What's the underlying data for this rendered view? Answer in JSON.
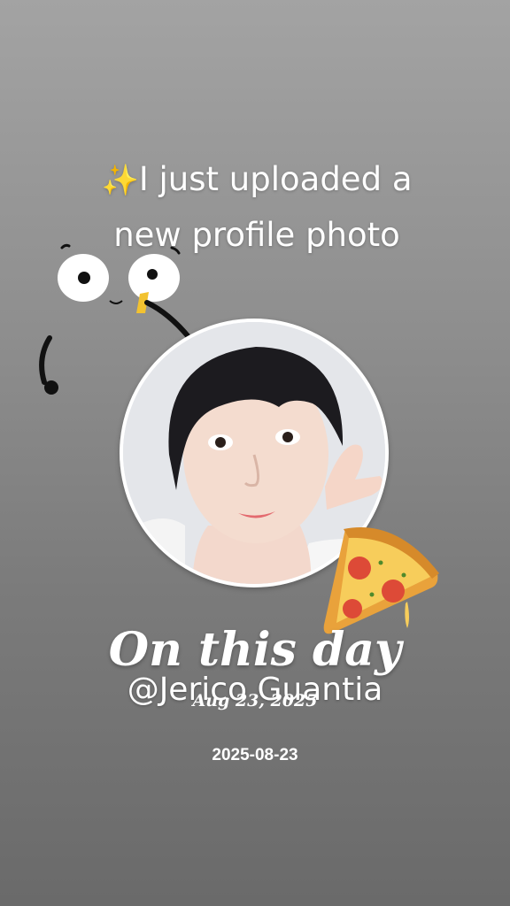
{
  "story": {
    "sparkle_icon": "✨",
    "headline_line1": "I just uploaded a",
    "headline_line2": "new profile photo",
    "title": "On this day",
    "username": "@Jerico Guantia",
    "date_long": "Aug 23, 2025",
    "date_iso": "2025-08-23"
  },
  "stickers": [
    "googly-eyes-face",
    "pizza-slice"
  ],
  "colors": {
    "background_top": "#a3a3a3",
    "background_bottom": "#6a6a6a",
    "text": "#ffffff",
    "ring": "#ffffff"
  }
}
